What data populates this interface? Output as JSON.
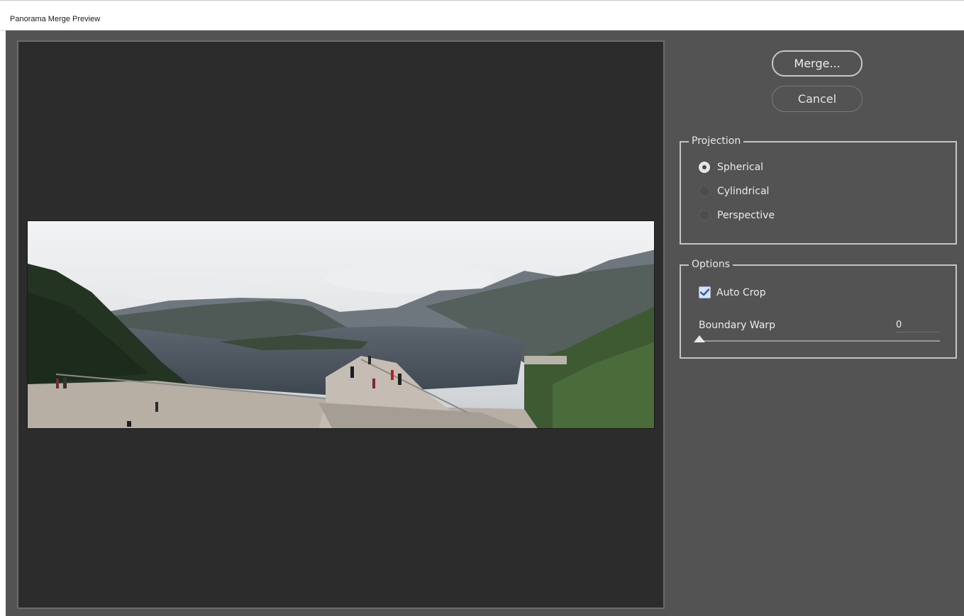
{
  "window": {
    "title": "Panorama Merge Preview"
  },
  "buttons": {
    "merge": "Merge...",
    "cancel": "Cancel"
  },
  "projection": {
    "legend": "Projection",
    "options": [
      {
        "label": "Spherical",
        "selected": true
      },
      {
        "label": "Cylindrical",
        "selected": false
      },
      {
        "label": "Perspective",
        "selected": false
      }
    ]
  },
  "options": {
    "legend": "Options",
    "auto_crop": {
      "label": "Auto Crop",
      "checked": true
    },
    "boundary_warp": {
      "label": "Boundary Warp",
      "value": "0"
    }
  },
  "colors": {
    "dialog_bg": "#535353",
    "preview_bg": "#2c2c2c",
    "checkbox_accent": "#3a63b8"
  }
}
